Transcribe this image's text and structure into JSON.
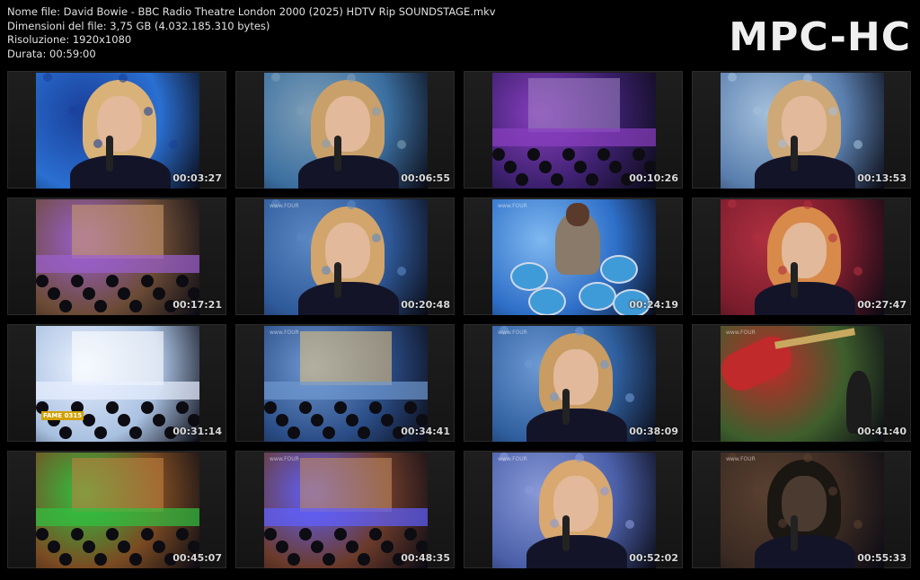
{
  "info": {
    "filename": "Nome file: David Bowie - BBC Radio Theatre London 2000 (2025) HDTV Rip SOUNDSTAGE.mkv",
    "filesize": "Dimensioni del file: 3,75 GB (4.032.185.310 bytes)",
    "resolution": "Risoluzione: 1920x1080",
    "duration": "Durata: 00:59:00"
  },
  "brand": "MPC-HC",
  "thumbnails": [
    {
      "time": "00:03:27",
      "scene": "closeup",
      "bg": "#2a6fd1",
      "accent": "#1a3f9a",
      "hair": "#d9b27a"
    },
    {
      "time": "00:06:55",
      "scene": "closeup",
      "bg": "#3b6fa0",
      "accent": "#7f9fb8",
      "hair": "#caa06a"
    },
    {
      "time": "00:10:26",
      "scene": "stage-band",
      "bg": "#3a1f6b",
      "accent": "#8a3fc1",
      "hair": "#9c7fc0"
    },
    {
      "time": "00:13:53",
      "scene": "closeup",
      "bg": "#5a7fae",
      "accent": "#a4c0dc",
      "hair": "#cfa877"
    },
    {
      "time": "00:17:21",
      "scene": "stage-wide",
      "bg": "#6b4b35",
      "accent": "#9b5fd0",
      "hair": "#c89a6a"
    },
    {
      "time": "00:20:48",
      "scene": "closeup",
      "bg": "#2f5a9a",
      "accent": "#5c88c4",
      "hair": "#d2a56c"
    },
    {
      "time": "00:24:19",
      "scene": "drummer",
      "bg": "#2e6fc8",
      "accent": "#7fb8f0",
      "hair": "#5a3a2a"
    },
    {
      "time": "00:27:47",
      "scene": "closeup",
      "bg": "#7a1c2c",
      "accent": "#b03040",
      "hair": "#d88a4a"
    },
    {
      "time": "00:31:14",
      "scene": "stage-wide-bright",
      "bg": "#a8c0e0",
      "accent": "#e8f0ff",
      "hair": "#ffffff"
    },
    {
      "time": "00:34:41",
      "scene": "stage-band",
      "bg": "#2a4c86",
      "accent": "#6f98d0",
      "hair": "#e0c080"
    },
    {
      "time": "00:38:09",
      "scene": "closeup",
      "bg": "#2f5f9e",
      "accent": "#6e9ad4",
      "hair": "#c89c62"
    },
    {
      "time": "00:41:40",
      "scene": "guitar",
      "bg": "#3e5e2c",
      "accent": "#c02a2a",
      "hair": "#7f9060"
    },
    {
      "time": "00:45:07",
      "scene": "stage-wide",
      "bg": "#7a4a22",
      "accent": "#30c040",
      "hair": "#c08040"
    },
    {
      "time": "00:48:35",
      "scene": "stage-wide",
      "bg": "#6a3a2a",
      "accent": "#6060ff",
      "hair": "#c08a60"
    },
    {
      "time": "00:52:02",
      "scene": "closeup",
      "bg": "#4a5fa8",
      "accent": "#8a9ad8",
      "hair": "#d8a870"
    },
    {
      "time": "00:55:33",
      "scene": "dark-closeup",
      "bg": "#3a2a22",
      "accent": "#5a4030",
      "hair": "#1a1612"
    }
  ],
  "watermark": "www.FOUR",
  "overlay_badge": "FAME 0315"
}
